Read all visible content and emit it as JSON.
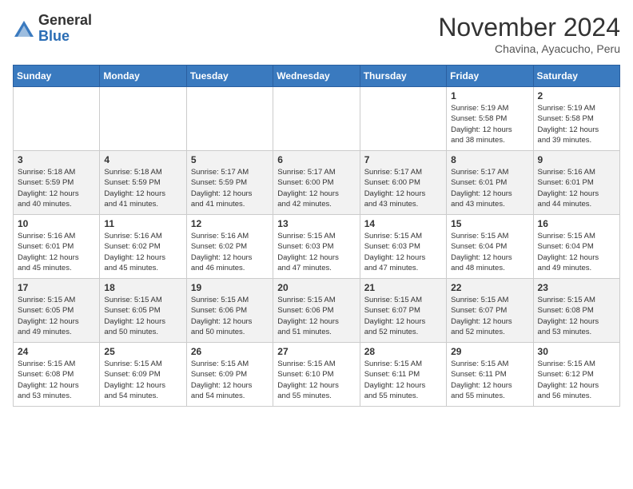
{
  "header": {
    "logo_line1": "General",
    "logo_line2": "Blue",
    "month_title": "November 2024",
    "location": "Chavina, Ayacucho, Peru"
  },
  "weekdays": [
    "Sunday",
    "Monday",
    "Tuesday",
    "Wednesday",
    "Thursday",
    "Friday",
    "Saturday"
  ],
  "weeks": [
    [
      {
        "day": "",
        "info": ""
      },
      {
        "day": "",
        "info": ""
      },
      {
        "day": "",
        "info": ""
      },
      {
        "day": "",
        "info": ""
      },
      {
        "day": "",
        "info": ""
      },
      {
        "day": "1",
        "info": "Sunrise: 5:19 AM\nSunset: 5:58 PM\nDaylight: 12 hours\nand 38 minutes."
      },
      {
        "day": "2",
        "info": "Sunrise: 5:19 AM\nSunset: 5:58 PM\nDaylight: 12 hours\nand 39 minutes."
      }
    ],
    [
      {
        "day": "3",
        "info": "Sunrise: 5:18 AM\nSunset: 5:59 PM\nDaylight: 12 hours\nand 40 minutes."
      },
      {
        "day": "4",
        "info": "Sunrise: 5:18 AM\nSunset: 5:59 PM\nDaylight: 12 hours\nand 41 minutes."
      },
      {
        "day": "5",
        "info": "Sunrise: 5:17 AM\nSunset: 5:59 PM\nDaylight: 12 hours\nand 41 minutes."
      },
      {
        "day": "6",
        "info": "Sunrise: 5:17 AM\nSunset: 6:00 PM\nDaylight: 12 hours\nand 42 minutes."
      },
      {
        "day": "7",
        "info": "Sunrise: 5:17 AM\nSunset: 6:00 PM\nDaylight: 12 hours\nand 43 minutes."
      },
      {
        "day": "8",
        "info": "Sunrise: 5:17 AM\nSunset: 6:01 PM\nDaylight: 12 hours\nand 43 minutes."
      },
      {
        "day": "9",
        "info": "Sunrise: 5:16 AM\nSunset: 6:01 PM\nDaylight: 12 hours\nand 44 minutes."
      }
    ],
    [
      {
        "day": "10",
        "info": "Sunrise: 5:16 AM\nSunset: 6:01 PM\nDaylight: 12 hours\nand 45 minutes."
      },
      {
        "day": "11",
        "info": "Sunrise: 5:16 AM\nSunset: 6:02 PM\nDaylight: 12 hours\nand 45 minutes."
      },
      {
        "day": "12",
        "info": "Sunrise: 5:16 AM\nSunset: 6:02 PM\nDaylight: 12 hours\nand 46 minutes."
      },
      {
        "day": "13",
        "info": "Sunrise: 5:15 AM\nSunset: 6:03 PM\nDaylight: 12 hours\nand 47 minutes."
      },
      {
        "day": "14",
        "info": "Sunrise: 5:15 AM\nSunset: 6:03 PM\nDaylight: 12 hours\nand 47 minutes."
      },
      {
        "day": "15",
        "info": "Sunrise: 5:15 AM\nSunset: 6:04 PM\nDaylight: 12 hours\nand 48 minutes."
      },
      {
        "day": "16",
        "info": "Sunrise: 5:15 AM\nSunset: 6:04 PM\nDaylight: 12 hours\nand 49 minutes."
      }
    ],
    [
      {
        "day": "17",
        "info": "Sunrise: 5:15 AM\nSunset: 6:05 PM\nDaylight: 12 hours\nand 49 minutes."
      },
      {
        "day": "18",
        "info": "Sunrise: 5:15 AM\nSunset: 6:05 PM\nDaylight: 12 hours\nand 50 minutes."
      },
      {
        "day": "19",
        "info": "Sunrise: 5:15 AM\nSunset: 6:06 PM\nDaylight: 12 hours\nand 50 minutes."
      },
      {
        "day": "20",
        "info": "Sunrise: 5:15 AM\nSunset: 6:06 PM\nDaylight: 12 hours\nand 51 minutes."
      },
      {
        "day": "21",
        "info": "Sunrise: 5:15 AM\nSunset: 6:07 PM\nDaylight: 12 hours\nand 52 minutes."
      },
      {
        "day": "22",
        "info": "Sunrise: 5:15 AM\nSunset: 6:07 PM\nDaylight: 12 hours\nand 52 minutes."
      },
      {
        "day": "23",
        "info": "Sunrise: 5:15 AM\nSunset: 6:08 PM\nDaylight: 12 hours\nand 53 minutes."
      }
    ],
    [
      {
        "day": "24",
        "info": "Sunrise: 5:15 AM\nSunset: 6:08 PM\nDaylight: 12 hours\nand 53 minutes."
      },
      {
        "day": "25",
        "info": "Sunrise: 5:15 AM\nSunset: 6:09 PM\nDaylight: 12 hours\nand 54 minutes."
      },
      {
        "day": "26",
        "info": "Sunrise: 5:15 AM\nSunset: 6:09 PM\nDaylight: 12 hours\nand 54 minutes."
      },
      {
        "day": "27",
        "info": "Sunrise: 5:15 AM\nSunset: 6:10 PM\nDaylight: 12 hours\nand 55 minutes."
      },
      {
        "day": "28",
        "info": "Sunrise: 5:15 AM\nSunset: 6:11 PM\nDaylight: 12 hours\nand 55 minutes."
      },
      {
        "day": "29",
        "info": "Sunrise: 5:15 AM\nSunset: 6:11 PM\nDaylight: 12 hours\nand 55 minutes."
      },
      {
        "day": "30",
        "info": "Sunrise: 5:15 AM\nSunset: 6:12 PM\nDaylight: 12 hours\nand 56 minutes."
      }
    ]
  ]
}
